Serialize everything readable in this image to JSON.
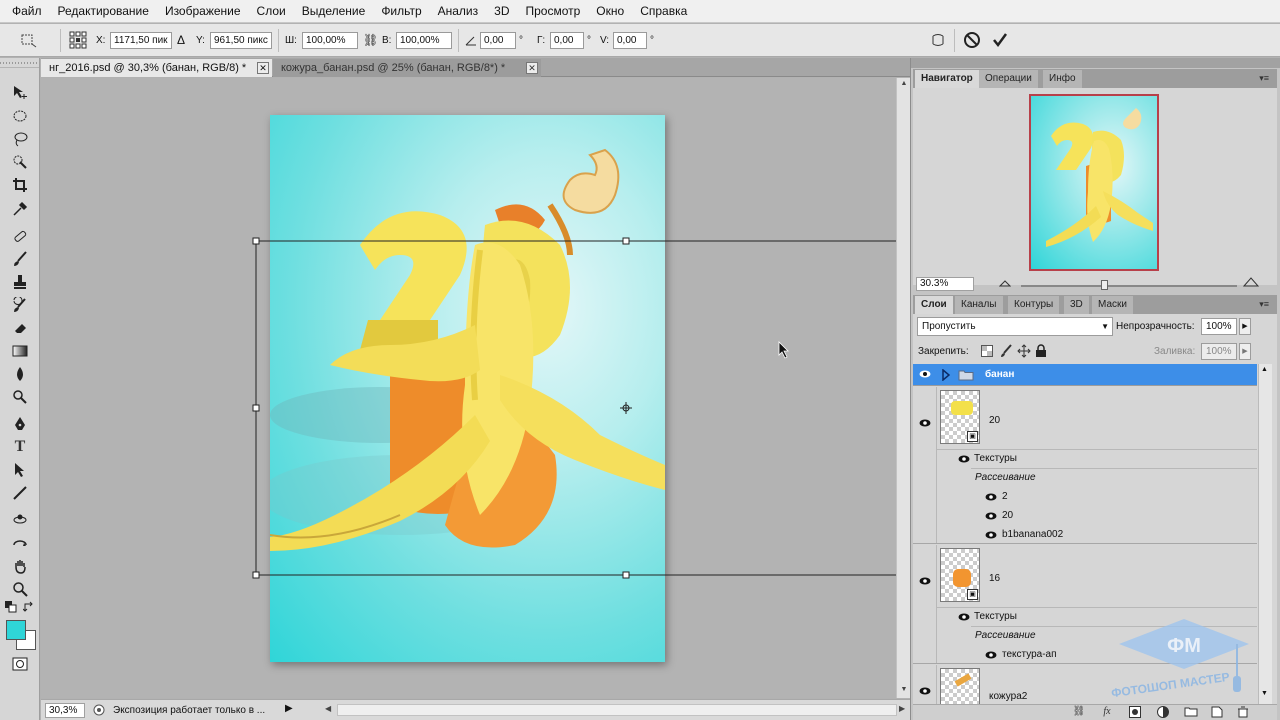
{
  "menu": [
    "Файл",
    "Редактирование",
    "Изображение",
    "Слои",
    "Выделение",
    "Фильтр",
    "Анализ",
    "3D",
    "Просмотр",
    "Окно",
    "Справка"
  ],
  "options": {
    "x_label": "X:",
    "x_value": "1171,50 пик",
    "y_label": "Y:",
    "y_value": "961,50 пикс",
    "w_label": "Ш:",
    "w_value": "100,00%",
    "h_label": "В:",
    "h_value": "100,00%",
    "angle_value": "0,00",
    "deg1": "°",
    "g_label": "Г:",
    "g_value": "0,00",
    "deg2": "°",
    "v_label": "V:",
    "v_value": "0,00",
    "deg3": "°"
  },
  "tabs": [
    {
      "label": "нг_2016.psd @ 30,3% (банан, RGB/8) *"
    },
    {
      "label": "кожура_банан.psd @ 25% (банан, RGB/8*) *"
    }
  ],
  "status": {
    "zoom": "30,3%",
    "message": "Экспозиция работает только в ..."
  },
  "navigator": {
    "tabs": [
      "Навигатор",
      "Операции",
      "Инфо"
    ],
    "zoom": "30.3%"
  },
  "layers_panel": {
    "tabs": [
      "Слои",
      "Каналы",
      "Контуры",
      "3D",
      "Маски"
    ],
    "blend_mode": "Пропустить",
    "opacity_label": "Непрозрачность:",
    "opacity_value": "100%",
    "lock_label": "Закрепить:",
    "fill_label": "Заливка:",
    "fill_value": "100%",
    "group_name": "банан",
    "layers": [
      {
        "name": "20",
        "effects_label": "Текстуры",
        "style_label": "Рассеивание",
        "items": [
          "2",
          "20",
          "b1banana002"
        ]
      },
      {
        "name": "16",
        "effects_label": "Текстуры",
        "style_label": "Рассеивание",
        "items": [
          "текстура-ап"
        ]
      },
      {
        "name": "кожура2"
      }
    ]
  },
  "colors": {
    "foreground": "#2fd5d8",
    "background": "#ffffff",
    "selection": "#3d8ee8"
  }
}
